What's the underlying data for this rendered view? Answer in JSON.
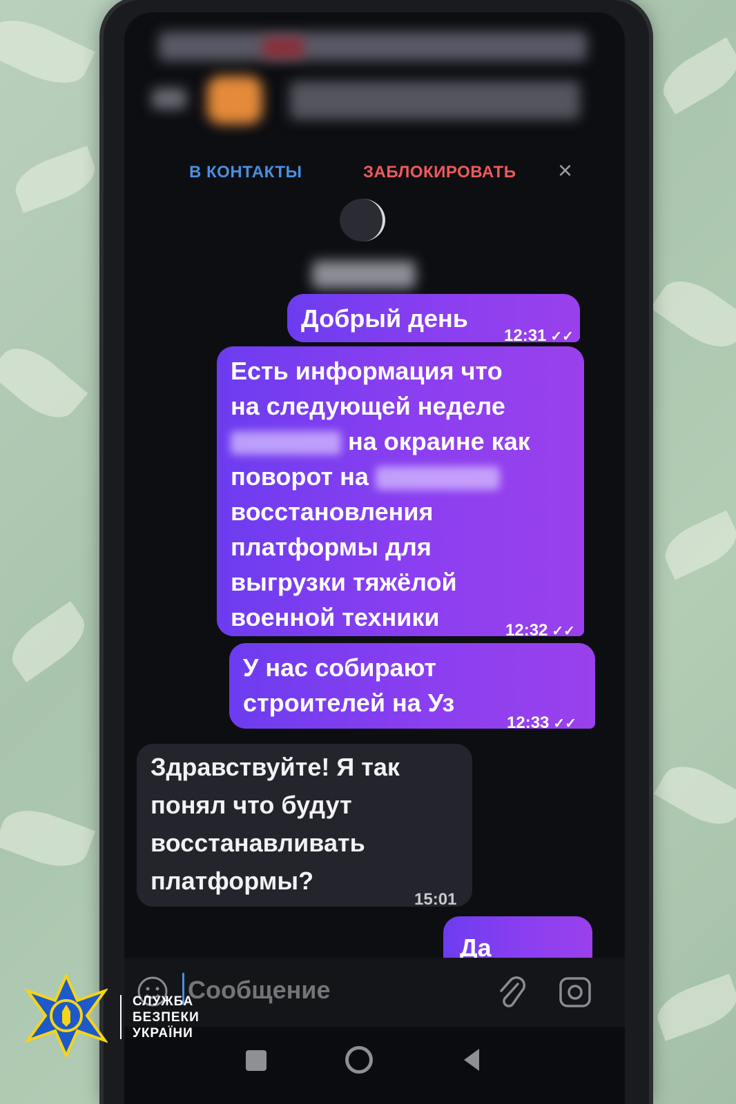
{
  "header": {
    "add_contact_label": "В КОНТАКТЫ",
    "block_label": "ЗАБЛОКИРОВАТЬ",
    "close_icon": "×",
    "accent_blue": "#4a8fe0",
    "accent_red": "#f05a5a"
  },
  "messages": [
    {
      "direction": "outgoing",
      "lines": [
        "Добрый день"
      ],
      "time": "12:31",
      "status_icon": "double-check-icon"
    },
    {
      "direction": "outgoing",
      "lines": [
        "Есть информация что",
        "на следующей неделе",
        "на окраине как",
        "поворот на",
        "восстановления",
        "платформы для",
        "выгрузки тяжёлой",
        "военной техники"
      ],
      "time": "12:32",
      "status_icon": "double-check-icon"
    },
    {
      "direction": "outgoing",
      "lines": [
        "У нас собирают",
        "строителей на Уз"
      ],
      "time": "12:33",
      "status_icon": "double-check-icon"
    },
    {
      "direction": "incoming",
      "lines": [
        "Здравствуйте! Я так",
        "понял что будут",
        "восстанавливать",
        "платформы?"
      ],
      "time": "15:01"
    },
    {
      "direction": "outgoing",
      "lines": [
        "Да"
      ],
      "partial": true
    }
  ],
  "composer": {
    "placeholder": "Сообщение",
    "emoji_icon": "emoji-icon",
    "attach_icon": "paperclip-icon",
    "camera_icon": "camera-icon"
  },
  "navigation": {
    "icons": [
      "square-icon",
      "circle-icon",
      "back-triangle-icon"
    ]
  },
  "watermark": {
    "line1": "СЛУЖБА",
    "line2": "БЕЗПЕКИ",
    "line3": "УКРАЇНИ",
    "emblem_color": "#1d59c9",
    "emblem_trim": "#f6d418"
  }
}
